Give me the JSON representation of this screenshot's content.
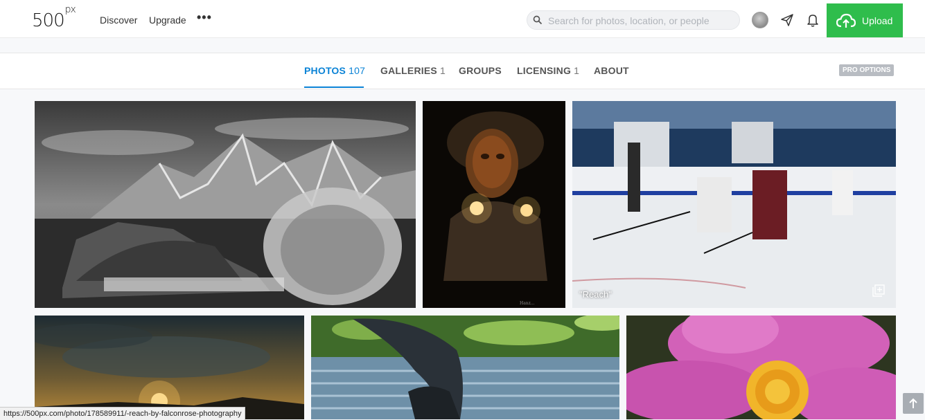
{
  "nav": {
    "logo": "500",
    "logo_sup": "px",
    "links": [
      "Discover",
      "Upgrade"
    ],
    "more": "•••",
    "search_placeholder": "Search for photos, location, or people",
    "upload_label": "Upload"
  },
  "tabs": [
    {
      "label": "PHOTOS",
      "count": "107",
      "active": true
    },
    {
      "label": "GALLERIES",
      "count": "1",
      "active": false
    },
    {
      "label": "GROUPS",
      "count": "",
      "active": false
    },
    {
      "label": "LICENSING",
      "count": "1",
      "active": false
    },
    {
      "label": "ABOUT",
      "count": "",
      "active": false
    }
  ],
  "pro_options": "PRO OPTIONS",
  "photos": [
    {
      "subject": "snowy mountain lake black and white"
    },
    {
      "subject": "carnival mask with lights"
    },
    {
      "subject": "ice hockey players",
      "title": "\"Reach\""
    },
    {
      "subject": "sunset over mountains"
    },
    {
      "subject": "goose spreading wings on water"
    },
    {
      "subject": "pink cosmos flower"
    }
  ],
  "status_url": "https://500px.com/photo/178589911/-reach-by-falconrose-photography",
  "colors": {
    "accent": "#0b83d6",
    "upload": "#2fbd4c"
  }
}
